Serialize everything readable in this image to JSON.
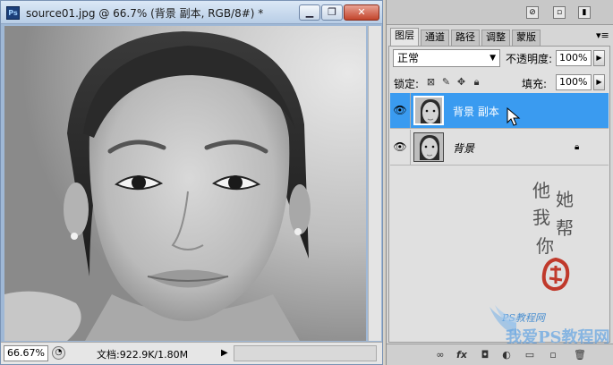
{
  "window": {
    "title": "source01.jpg @ 66.7% (背景 副本, RGB/8#) *",
    "app_icon": "Ps",
    "minimize_icon": "minimize-icon",
    "maximize_icon": "maximize-icon",
    "close_icon": "close-icon"
  },
  "status": {
    "zoom": "66.67%",
    "doc_info": "文档:922.9K/1.80M",
    "arrow": "▶"
  },
  "panel": {
    "tabs": [
      {
        "label": "图层",
        "active": true
      },
      {
        "label": "通道",
        "active": false
      },
      {
        "label": "路径",
        "active": false
      },
      {
        "label": "调整",
        "active": false
      },
      {
        "label": "蒙版",
        "active": false
      }
    ],
    "menu_glyph": "▾≡",
    "blend_mode": "正常",
    "opacity_label": "不透明度:",
    "opacity_value": "100%",
    "lock_label": "锁定:",
    "fill_label": "填充:",
    "fill_value": "100%"
  },
  "layers": [
    {
      "name": "背景 副本",
      "selected": true,
      "visible": true,
      "locked": false
    },
    {
      "name": "背景",
      "selected": false,
      "visible": true,
      "locked": true
    }
  ],
  "watermark": {
    "chars": [
      "他",
      "她",
      "我",
      "帮",
      "你"
    ],
    "site_small": "PS教程网",
    "site_big": "我爱PS教程网"
  },
  "colors": {
    "selection": "#3a9bf0",
    "panel_bg": "#d6d6d6",
    "title_gradient_top": "#dbe8f6",
    "seal_red": "#c0392b"
  }
}
